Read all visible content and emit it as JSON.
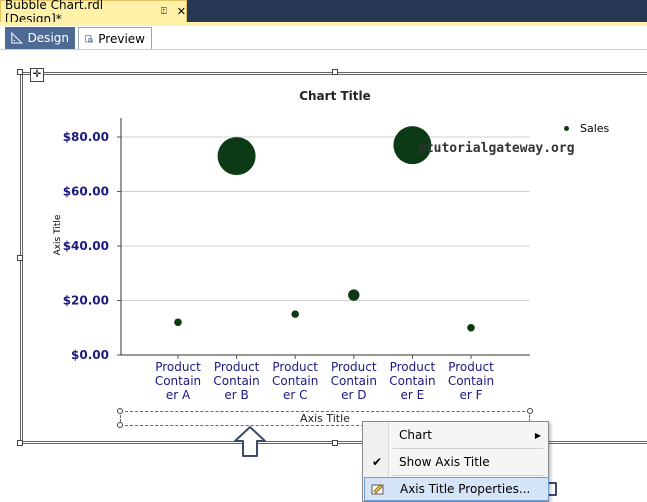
{
  "doc_tab": {
    "title": "Bubble Chart.rdl [Design]*",
    "pin": "⍐",
    "close": "✕"
  },
  "view_tabs": [
    {
      "label": "Design"
    },
    {
      "label": "Preview"
    }
  ],
  "chart": {
    "title": "Chart Title",
    "y_axis_title": "Axis Title",
    "x_axis_title": "Axis Title",
    "legend": {
      "label": "Sales"
    },
    "watermark": "@tutorialgateway.org",
    "colors": {
      "bubble": "#0b3a14",
      "axis_label": "#1a1a80"
    }
  },
  "chart_data": {
    "type": "scatter",
    "title": "Chart Title",
    "xlabel": "Axis Title",
    "ylabel": "Axis Title",
    "ylim": [
      0,
      80
    ],
    "y_ticks": [
      "$0.00",
      "$20.00",
      "$40.00",
      "$60.00",
      "$80.00"
    ],
    "categories": [
      "Product Container A",
      "Product Container B",
      "Product Container C",
      "Product Container D",
      "Product Container E",
      "Product Container F"
    ],
    "category_tick_lines": [
      [
        "Product",
        "Contain",
        "er A"
      ],
      [
        "Product",
        "Contain",
        "er B"
      ],
      [
        "Product",
        "Contain",
        "er C"
      ],
      [
        "Product",
        "Contain",
        "er D"
      ],
      [
        "Product",
        "Contain",
        "er E"
      ],
      [
        "Product",
        "Contain",
        "er F"
      ]
    ],
    "series": [
      {
        "name": "Sales",
        "values": [
          12,
          73,
          15,
          22,
          77,
          10
        ],
        "bubble_size": [
          1,
          5,
          1,
          1.5,
          5,
          1
        ]
      }
    ],
    "grid": true,
    "legend_position": "top-right"
  },
  "context_menu": {
    "items": [
      {
        "label": "Chart",
        "has_submenu": true,
        "checked": false
      },
      {
        "label": "Show Axis Title",
        "has_submenu": false,
        "checked": true
      },
      {
        "label": "Axis Title Properties...",
        "has_submenu": false,
        "checked": false,
        "highlighted": true
      }
    ]
  }
}
